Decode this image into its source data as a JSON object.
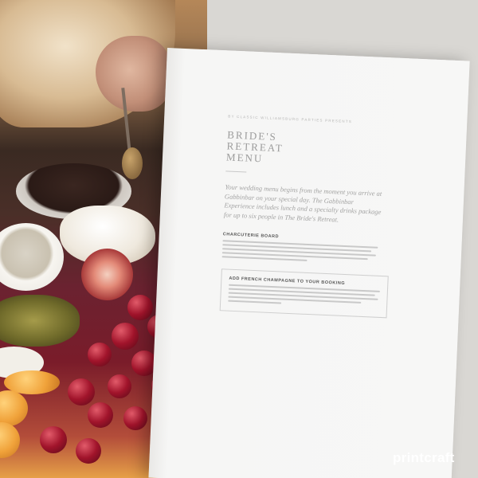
{
  "photo": {
    "description_icons": [
      "bread-loaf",
      "hand-with-spoon",
      "grazing-board"
    ]
  },
  "menu_page": {
    "running_head": "BY CLASSIC WILLIAMSBURG PARTIES PRESENTS",
    "title": "BRIDE'S RETREAT MENU",
    "intro": "Your wedding menu begins from the moment you arrive at Gabbinbar on your special day. The Gabbinbar Experience includes lunch and a specialty drinks package for up to six people in The Bride's Retreat.",
    "section_heading": "CHARCUTERIE BOARD",
    "addon_heading": "ADD FRENCH CHAMPAGNE TO YOUR BOOKING"
  },
  "watermark": {
    "brand": "printcraft"
  }
}
